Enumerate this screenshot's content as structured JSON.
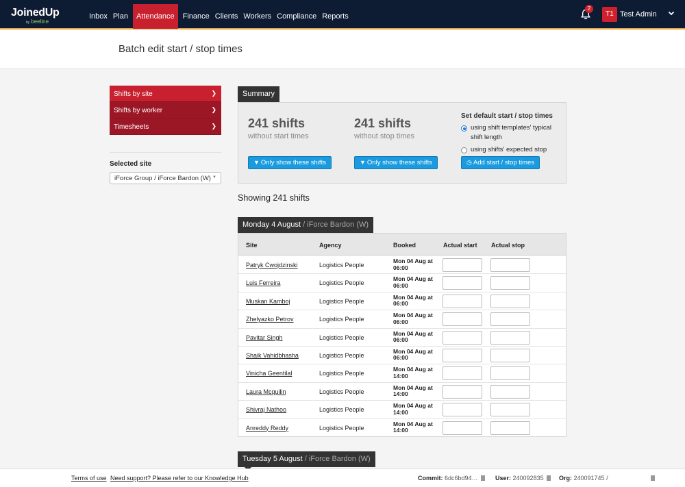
{
  "brand": {
    "name": "JoinedUp",
    "by": "by",
    "partner": "beeline"
  },
  "nav": {
    "items": [
      "Inbox",
      "Plan",
      "Attendance",
      "Finance",
      "Clients",
      "Workers",
      "Compliance",
      "Reports"
    ],
    "active": "Attendance"
  },
  "notifications": {
    "count": "2"
  },
  "user": {
    "initials": "T1",
    "name": "Test Admin"
  },
  "page": {
    "title": "Batch edit start / stop times"
  },
  "sidebar": {
    "items": [
      {
        "label": "Shifts by site",
        "active": true
      },
      {
        "label": "Shifts by worker",
        "active": false
      },
      {
        "label": "Timesheets",
        "active": false
      }
    ],
    "selected_site_label": "Selected site",
    "selected_site_value": "iForce Group / iForce Bardon (W)"
  },
  "summary": {
    "tab": "Summary",
    "without_start": {
      "count": "241 shifts",
      "caption": "without start times",
      "button": "Only show these shifts"
    },
    "without_stop": {
      "count": "241 shifts",
      "caption": "without stop times",
      "button": "Only show these shifts"
    },
    "defaults": {
      "heading": "Set default start / stop times",
      "option1": "using shift templates' typical shift length",
      "option2": "using shifts' expected stop",
      "selected": 1,
      "button": "Add start / stop times"
    }
  },
  "showing": "Showing 241 shifts",
  "day_groups": [
    {
      "date": "Monday 4 August",
      "site": " / iForce Bardon (W)"
    },
    {
      "date": "Tuesday 5 August",
      "site": " / iForce Bardon (W)"
    }
  ],
  "table": {
    "headers": {
      "site": "Site",
      "agency": "Agency",
      "booked": "Booked",
      "actual_start": "Actual start",
      "actual_stop": "Actual stop"
    },
    "rows": [
      {
        "worker": "Patryk Cwojdzinski",
        "agency": "Logistics People",
        "booked_1": "Mon 04 Aug at",
        "booked_2": "06:00"
      },
      {
        "worker": "Luis Ferreira",
        "agency": "Logistics People",
        "booked_1": "Mon 04 Aug at",
        "booked_2": "06:00"
      },
      {
        "worker": "Muskan Kamboj",
        "agency": "Logistics People",
        "booked_1": "Mon 04 Aug at",
        "booked_2": "06:00"
      },
      {
        "worker": "Zhelyazko Petrov",
        "agency": "Logistics People",
        "booked_1": "Mon 04 Aug at",
        "booked_2": "06:00"
      },
      {
        "worker": "Pavitar Singh",
        "agency": "Logistics People",
        "booked_1": "Mon 04 Aug at",
        "booked_2": "06:00"
      },
      {
        "worker": "Shaik Vahidbhasha",
        "agency": "Logistics People",
        "booked_1": "Mon 04 Aug at",
        "booked_2": "06:00"
      },
      {
        "worker": "Vinicha Geentilal",
        "agency": "Logistics People",
        "booked_1": "Mon 04 Aug at",
        "booked_2": "14:00"
      },
      {
        "worker": "Laura Mcquilin",
        "agency": "Logistics People",
        "booked_1": "Mon 04 Aug at",
        "booked_2": "14:00"
      },
      {
        "worker": "Shivraj Nathoo",
        "agency": "Logistics People",
        "booked_1": "Mon 04 Aug at",
        "booked_2": "14:00"
      },
      {
        "worker": "Anreddy Reddy",
        "agency": "Logistics People",
        "booked_1": "Mon 04 Aug at",
        "booked_2": "14:00"
      }
    ]
  },
  "footer": {
    "terms": "Terms of use",
    "support": "Need support? Please refer to our Knowledge Hub",
    "commit_label": "Commit:",
    "commit_value": "6dc6bd94…",
    "user_label": "User:",
    "user_value": "240092835",
    "org_label": "Org:",
    "org_value": "240091745 /"
  },
  "colors": {
    "nav_bg": "#0d1b33",
    "accent_red": "#c8202f",
    "sidebar_red": "#9c1726",
    "button_blue": "#1a9be0",
    "nav_underline": "#e8a33d"
  },
  "icons": [
    "bell-icon",
    "chevron-down-icon",
    "chevron-right-icon",
    "filter-icon",
    "clock-icon",
    "copy-icon"
  ]
}
